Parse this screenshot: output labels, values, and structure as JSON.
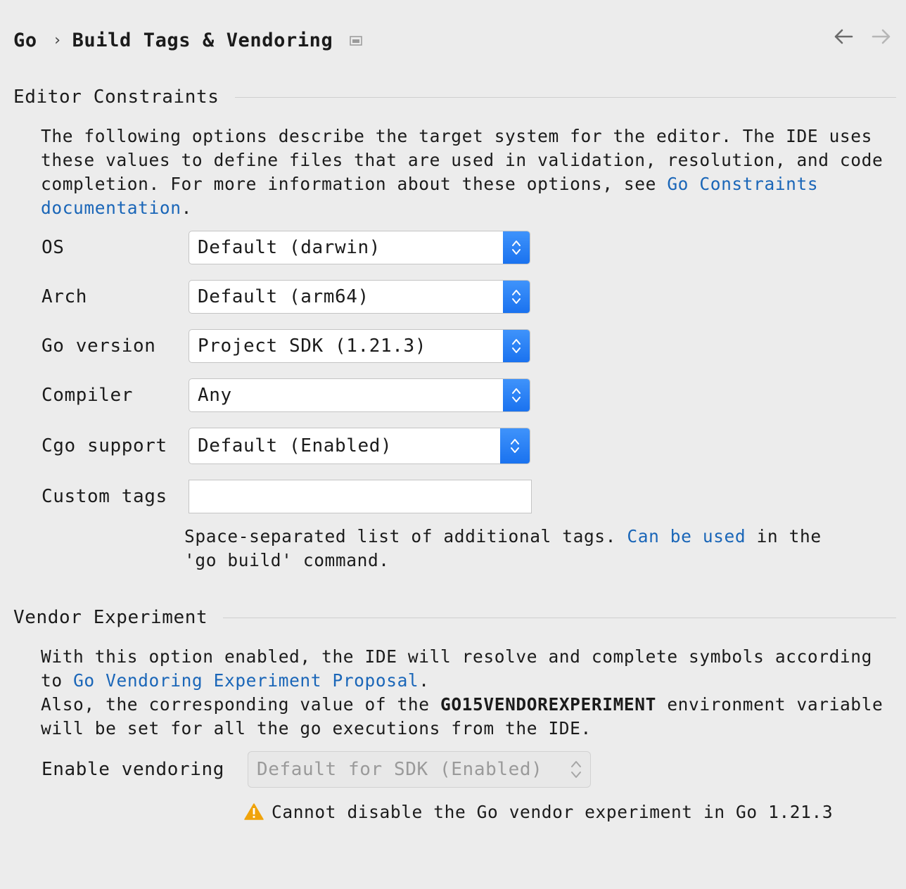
{
  "breadcrumb": {
    "parent": "Go",
    "separator": "›",
    "current": "Build Tags & Vendoring"
  },
  "editor_constraints": {
    "title": "Editor Constraints",
    "description_before_link": "The following options describe the target system for the editor. The IDE uses these values to define files that are used in validation, resolution, and code completion. For more information about these options, see ",
    "description_link": "Go Constraints documentation",
    "description_after_link": ".",
    "fields": {
      "os": {
        "label": "OS",
        "value": "Default (darwin)"
      },
      "arch": {
        "label": "Arch",
        "value": "Default (arm64)"
      },
      "go_version": {
        "label": "Go version",
        "value": "Project SDK (1.21.3)"
      },
      "compiler": {
        "label": "Compiler",
        "value": "Any"
      },
      "cgo": {
        "label": "Cgo support",
        "value": "Default (Enabled)"
      },
      "custom_tags": {
        "label": "Custom tags",
        "value": ""
      }
    },
    "hint_before_link": "Space-separated list of additional tags. ",
    "hint_link": "Can be used",
    "hint_after_link": " in the 'go build' command."
  },
  "vendor_experiment": {
    "title": "Vendor Experiment",
    "desc_before_link": "With this option enabled, the IDE will resolve and complete symbols according to ",
    "desc_link": "Go Vendoring Experiment Proposal",
    "desc_after_link": ".",
    "desc2_before": "Also, the corresponding value of the ",
    "desc2_bold": "GO15VENDOREXPERIMENT",
    "desc2_after": " environment variable will be set for all the go executions from the IDE.",
    "enable_label": "Enable vendoring",
    "enable_value": "Default for SDK (Enabled)",
    "warning": "Cannot disable the Go vendor experiment in Go 1.21.3"
  },
  "colors": {
    "accent": "#1a72ef",
    "link": "#1a66b8",
    "warning": "#f0a30a"
  }
}
